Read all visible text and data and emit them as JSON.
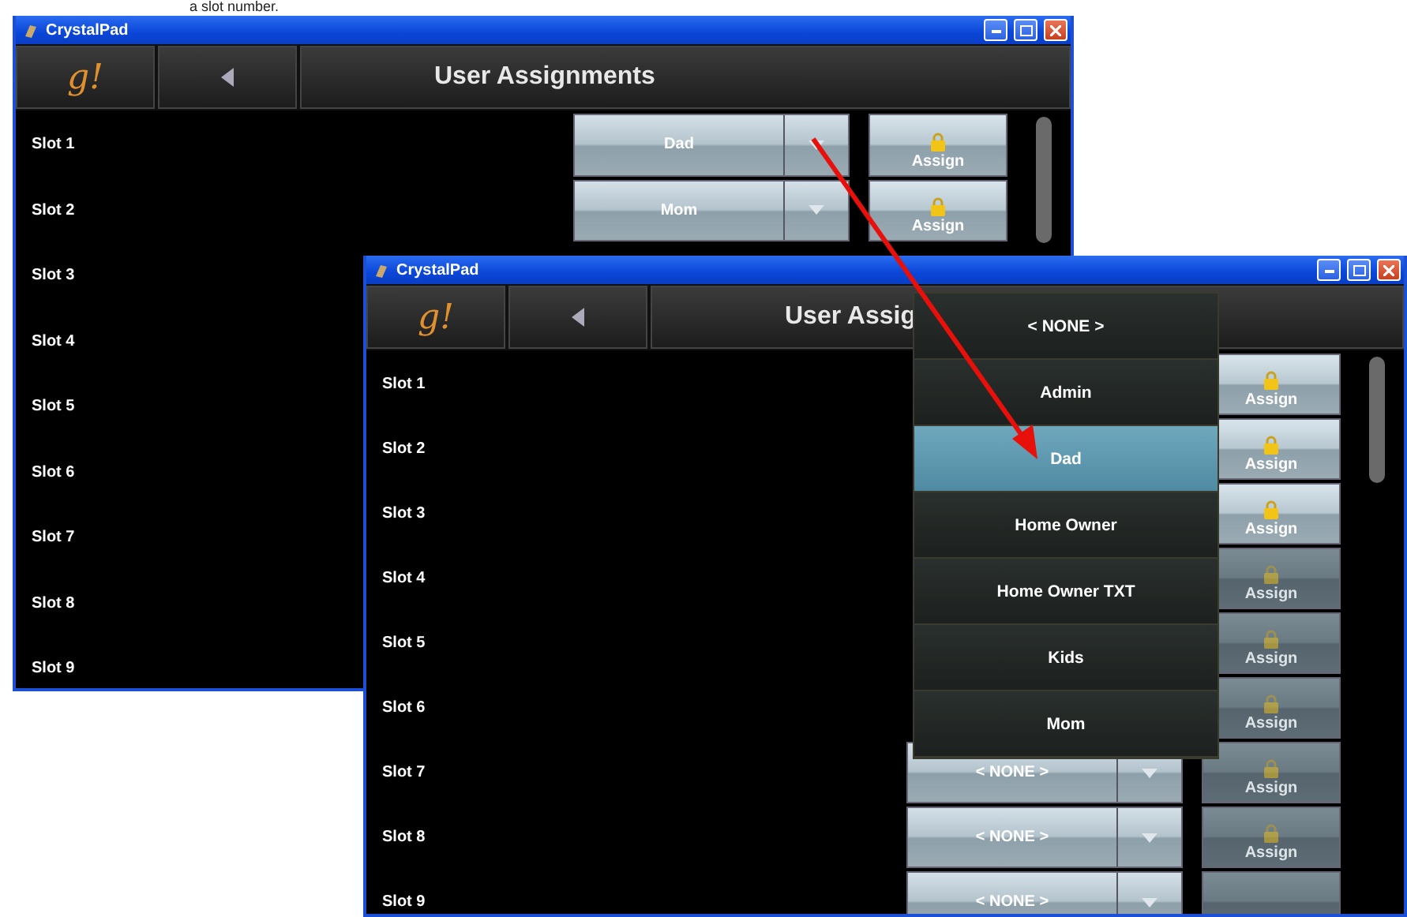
{
  "caption": "a slot number.",
  "windows": [
    {
      "title": "CrystalPad",
      "logo": "g!",
      "heading": "User Assignments",
      "slots": [
        {
          "label": "Slot 1",
          "user": "Dad",
          "assign": "Assign",
          "disabled": false
        },
        {
          "label": "Slot 2",
          "user": "Mom",
          "assign": "Assign",
          "disabled": false
        },
        {
          "label": "Slot 3"
        },
        {
          "label": "Slot 4"
        },
        {
          "label": "Slot 5"
        },
        {
          "label": "Slot 6"
        },
        {
          "label": "Slot 7"
        },
        {
          "label": "Slot 8"
        },
        {
          "label": "Slot 9"
        }
      ]
    },
    {
      "title": "CrystalPad",
      "logo": "g!",
      "heading": "User Assig",
      "slots": [
        {
          "label": "Slot 1",
          "assign": "Assign",
          "disabled": false
        },
        {
          "label": "Slot 2",
          "assign": "Assign",
          "disabled": false
        },
        {
          "label": "Slot 3",
          "assign": "Assign",
          "disabled": false
        },
        {
          "label": "Slot 4",
          "assign": "Assign",
          "disabled": true
        },
        {
          "label": "Slot 5",
          "assign": "Assign",
          "disabled": true
        },
        {
          "label": "Slot 6",
          "assign": "Assign",
          "disabled": true
        },
        {
          "label": "Slot 7",
          "user": "< NONE >",
          "assign": "Assign",
          "disabled": true
        },
        {
          "label": "Slot 8",
          "user": "< NONE >",
          "assign": "Assign",
          "disabled": true
        },
        {
          "label": "Slot 9",
          "user": "< NONE >",
          "disabled": true
        }
      ]
    }
  ],
  "dropdown": {
    "options": [
      {
        "label": "< NONE >",
        "selected": false
      },
      {
        "label": "Admin",
        "selected": false
      },
      {
        "label": "Dad",
        "selected": true
      },
      {
        "label": "Home Owner",
        "selected": false
      },
      {
        "label": "Home Owner TXT",
        "selected": false
      },
      {
        "label": "Kids",
        "selected": false
      },
      {
        "label": "Mom",
        "selected": false
      }
    ]
  }
}
